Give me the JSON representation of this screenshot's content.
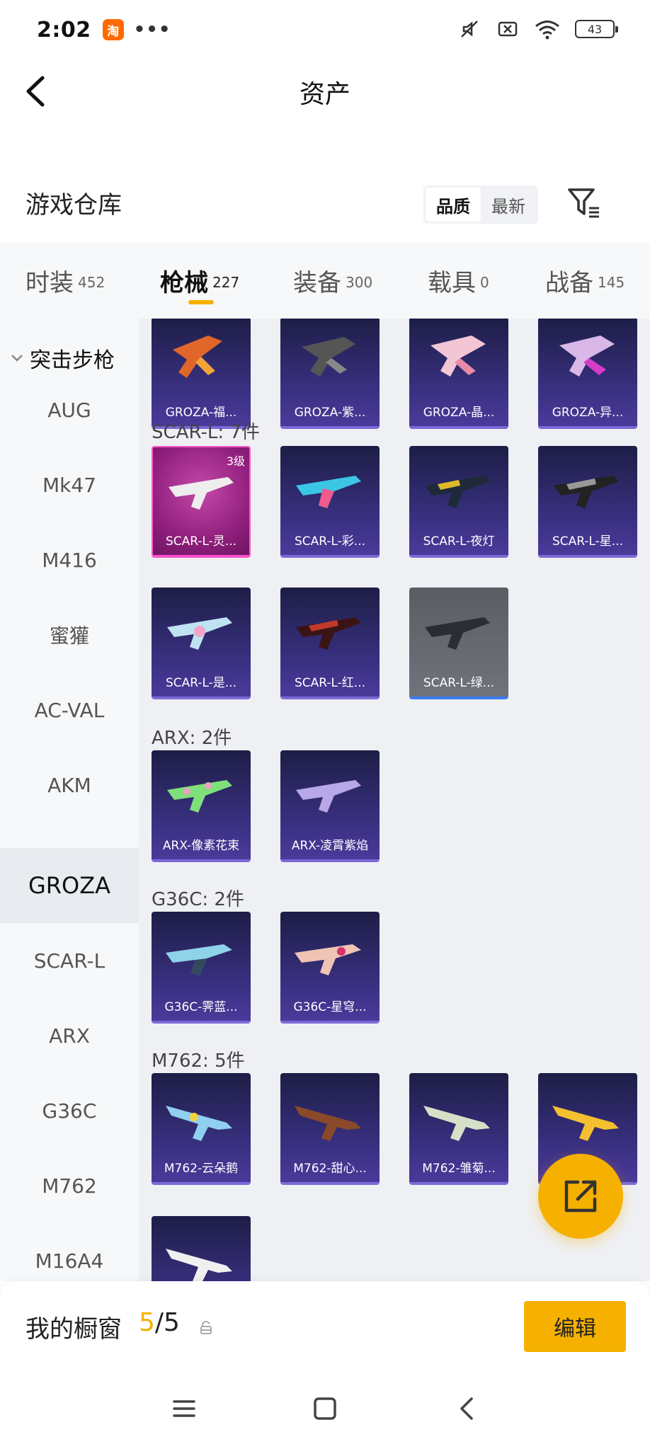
{
  "status_bar": {
    "time": "2:02",
    "app_badge": "淘",
    "more_dots": "•••",
    "battery": "43"
  },
  "nav": {
    "title": "资产"
  },
  "warehouse": {
    "title": "游戏仓库",
    "sort_options": [
      "品质",
      "最新"
    ],
    "active_sort": "品质"
  },
  "tabs": [
    {
      "label": "时装",
      "count": "452"
    },
    {
      "label": "枪械",
      "count": "227"
    },
    {
      "label": "装备",
      "count": "300"
    },
    {
      "label": "载具",
      "count": "0"
    },
    {
      "label": "战备",
      "count": "145"
    }
  ],
  "active_tab": "枪械",
  "sidebar": {
    "header": "突击步枪",
    "items": [
      "AUG",
      "Mk47",
      "M416",
      "蜜獾",
      "AC-VAL",
      "AKM",
      "GROZA",
      "SCAR-L",
      "ARX",
      "G36C",
      "M762",
      "M16A4"
    ],
    "active": "GROZA"
  },
  "sections": [
    {
      "title": "",
      "items": [
        "GROZA-福...",
        "GROZA-紫...",
        "GROZA-晶...",
        "GROZA-异..."
      ]
    },
    {
      "title": "SCAR-L: 7件",
      "items": [
        "SCAR-L-灵...",
        "SCAR-L-彩...",
        "SCAR-L-夜灯",
        "SCAR-L-星...",
        "SCAR-L-是...",
        "SCAR-L-红...",
        "SCAR-L-绿..."
      ],
      "badge": "3级"
    },
    {
      "title": "ARX: 2件",
      "items": [
        "ARX-像素花束",
        "ARX-凌霄紫焰"
      ]
    },
    {
      "title": "G36C: 2件",
      "items": [
        "G36C-霁蓝...",
        "G36C-星穹..."
      ]
    },
    {
      "title": "M762: 5件",
      "items": [
        "M762-云朵鹅",
        "M762-甜心...",
        "M762-雏菊...",
        ""
      ]
    }
  ],
  "showcase": {
    "label": "我的橱窗",
    "current": "5",
    "total": "/5"
  },
  "edit_label": "编辑",
  "colors": {
    "accent": "#f6b000",
    "card_purple": "#3b3184",
    "card_pink": "#93207f",
    "card_gray": "#6f737b"
  }
}
